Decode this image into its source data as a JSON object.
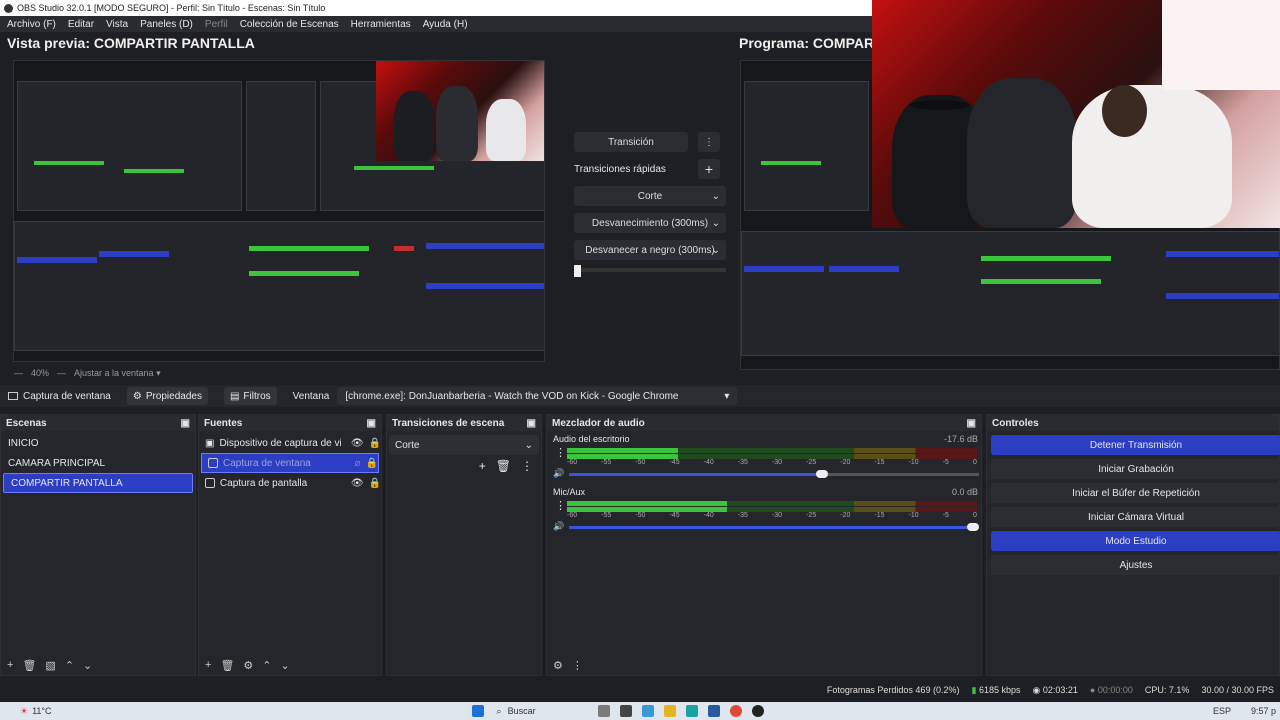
{
  "window": {
    "title": "OBS Studio 32.0.1 [MODO SEGURO] - Perfil: Sin Título - Escenas: Sin Título"
  },
  "menu": [
    "Archivo (F)",
    "Editar",
    "Vista",
    "Paneles (D)",
    "Perfil",
    "Colección de Escenas",
    "Herramientas",
    "Ayuda (H)"
  ],
  "preview": {
    "title": "Vista previa: COMPARTIR PANTALLA",
    "zoom": "40%",
    "fit_label": "Ajustar a la ventana"
  },
  "program": {
    "title": "Programa: COMPARTIR PANTALLA"
  },
  "transition_panel": {
    "transition_button": "Transición",
    "quick_transitions_label": "Transiciones rápidas",
    "options": [
      "Corte",
      "Desvanecimiento (300ms)",
      "Desvanecer a negro (300ms)"
    ]
  },
  "source_bar": {
    "source_name": "Captura de ventana",
    "properties": "Propiedades",
    "filters": "Filtros",
    "window_label": "Ventana",
    "window_value": "[chrome.exe]: DonJuanbarberia - Watch the VOD on Kick - Google Chrome"
  },
  "scenes": {
    "title": "Escenas",
    "items": [
      "INICIO",
      "CAMARA PRINCIPAL",
      "COMPARTIR PANTALLA"
    ],
    "selected": "COMPARTIR PANTALLA"
  },
  "sources": {
    "title": "Fuentes",
    "items": [
      "Dispositivo de captura de vide",
      "Captura de ventana",
      "Captura de pantalla"
    ]
  },
  "scene_transitions": {
    "title": "Transiciones de escena",
    "selected": "Corte"
  },
  "audio_mixer": {
    "title": "Mezclador de audio",
    "ticks": [
      "-60",
      "-55",
      "-50",
      "-45",
      "-40",
      "-35",
      "-30",
      "-25",
      "-20",
      "-15",
      "-10",
      "-5",
      "0"
    ],
    "channels": [
      {
        "name": "Audio del escritorio",
        "db": "-17.6 dB",
        "level": 0.27,
        "volume": 0.62
      },
      {
        "name": "Mic/Aux",
        "db": "0.0 dB",
        "level": 0.39,
        "volume": 1.0
      }
    ]
  },
  "controls": {
    "title": "Controles",
    "buttons": [
      {
        "label": "Detener Transmisión",
        "active": true
      },
      {
        "label": "Iniciar Grabación",
        "active": false
      },
      {
        "label": "Iniciar el Búfer de Repetición",
        "active": false
      },
      {
        "label": "Iniciar Cámara Virtual",
        "active": false
      },
      {
        "label": "Modo Estudio",
        "active": true
      },
      {
        "label": "Ajustes",
        "active": false
      }
    ]
  },
  "status": {
    "dropped_frames": "Fotogramas Perdidos 469 (0.2%)",
    "bitrate": "6185 kbps",
    "stream_time": "02:03:21",
    "rec_time": "00:00:00",
    "cpu": "CPU: 7.1%",
    "fps": "30.00 / 30.00 FPS"
  },
  "taskbar": {
    "weather": "11°C",
    "search": "Buscar",
    "lang": "ESP",
    "time": "9:57 p"
  },
  "colors": {
    "accent": "#2c3fc4",
    "meter_green": "#3dc43d",
    "meter_yellow": "#b8a32a",
    "meter_red": "#b82a2a"
  }
}
